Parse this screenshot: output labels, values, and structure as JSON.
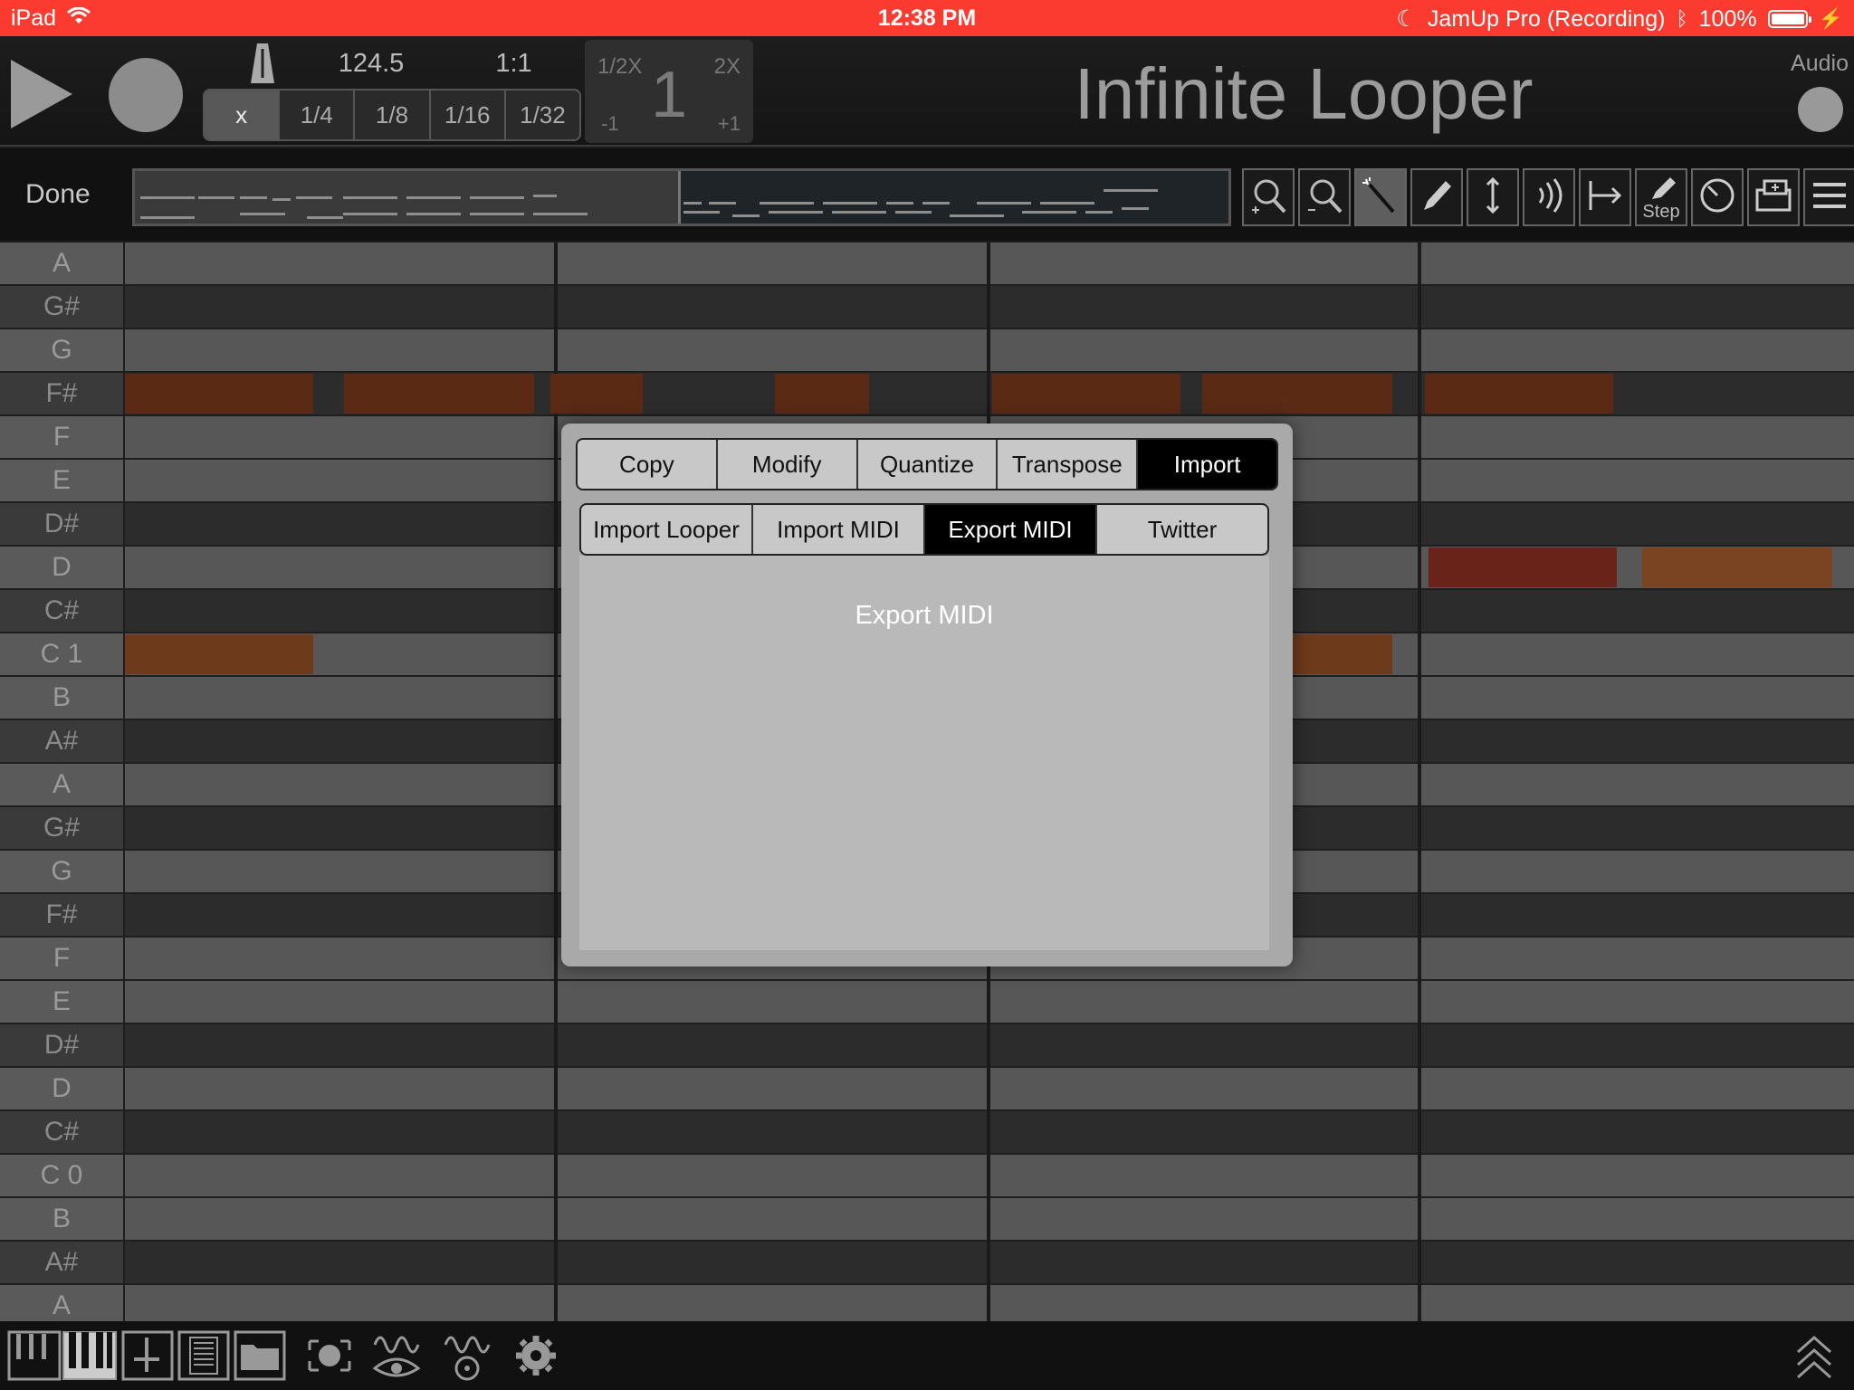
{
  "status_bar": {
    "device": "iPad",
    "time": "12:38 PM",
    "app_status": "JamUp Pro (Recording)",
    "battery": "100%"
  },
  "toolbar": {
    "tempo": "124.5",
    "time_signature": "1:1",
    "quantize_options": [
      "x",
      "1/4",
      "1/8",
      "1/16",
      "1/32"
    ],
    "quantize_selected": "x",
    "speed": {
      "half": "1/2X",
      "double": "2X",
      "value": "1",
      "minus": "-1",
      "plus": "+1"
    },
    "title": "Infinite Looper",
    "audio_label": "Audio"
  },
  "edit_bar": {
    "done_label": "Done",
    "tools": [
      {
        "name": "zoom-in-icon",
        "label": ""
      },
      {
        "name": "zoom-out-icon",
        "label": ""
      },
      {
        "name": "magic-wand-icon",
        "label": ""
      },
      {
        "name": "pencil-icon",
        "label": ""
      },
      {
        "name": "vertical-arrows-icon",
        "label": ""
      },
      {
        "name": "velocity-icon",
        "label": ""
      },
      {
        "name": "length-arrow-icon",
        "label": ""
      },
      {
        "name": "step-pencil-icon",
        "label": "Step"
      },
      {
        "name": "knob-icon",
        "label": ""
      },
      {
        "name": "add-window-icon",
        "label": ""
      },
      {
        "name": "menu-icon",
        "label": ""
      }
    ],
    "selected_tool": "magic-wand-icon"
  },
  "piano_roll": {
    "keys": [
      {
        "label": "A",
        "color": "white"
      },
      {
        "label": "G#",
        "color": "black"
      },
      {
        "label": "G",
        "color": "white"
      },
      {
        "label": "F#",
        "color": "black"
      },
      {
        "label": "F",
        "color": "white"
      },
      {
        "label": "E",
        "color": "white"
      },
      {
        "label": "D#",
        "color": "black"
      },
      {
        "label": "D",
        "color": "white"
      },
      {
        "label": "C#",
        "color": "black"
      },
      {
        "label": "C  1",
        "color": "white"
      },
      {
        "label": "B",
        "color": "white"
      },
      {
        "label": "A#",
        "color": "black"
      },
      {
        "label": "A",
        "color": "white"
      },
      {
        "label": "G#",
        "color": "black"
      },
      {
        "label": "G",
        "color": "white"
      },
      {
        "label": "F#",
        "color": "black"
      },
      {
        "label": "F",
        "color": "white"
      },
      {
        "label": "E",
        "color": "white"
      },
      {
        "label": "D#",
        "color": "black"
      },
      {
        "label": "D",
        "color": "white"
      },
      {
        "label": "C#",
        "color": "black"
      },
      {
        "label": "C  0",
        "color": "white"
      },
      {
        "label": "B",
        "color": "white"
      },
      {
        "label": "A#",
        "color": "black"
      },
      {
        "label": "A",
        "color": "white"
      }
    ],
    "note_colors": {
      "dark": "#5a2a15",
      "mid": "#6e3a1c",
      "red": "#6a2318",
      "light": "#7a4422"
    }
  },
  "popover": {
    "tabs": [
      "Copy",
      "Modify",
      "Quantize",
      "Transpose",
      "Import"
    ],
    "selected_tab": "Import",
    "subtabs": [
      "Import Looper",
      "Import MIDI",
      "Export MIDI",
      "Twitter"
    ],
    "selected_subtab": "Export MIDI",
    "content_title": "Export MIDI"
  },
  "bottom_bar": {
    "icons": [
      "piano-keys-icon",
      "keyboard-icon",
      "mixer-icon",
      "list-icon",
      "folder-icon",
      "capture-icon",
      "eye-wave-icon",
      "joystick-wave-icon",
      "gear-icon",
      "chevron-up-icon"
    ]
  },
  "colors": {
    "status_bar": "#fb3b2f",
    "selected_segment": "#000000",
    "note": "#6e3a1c"
  }
}
